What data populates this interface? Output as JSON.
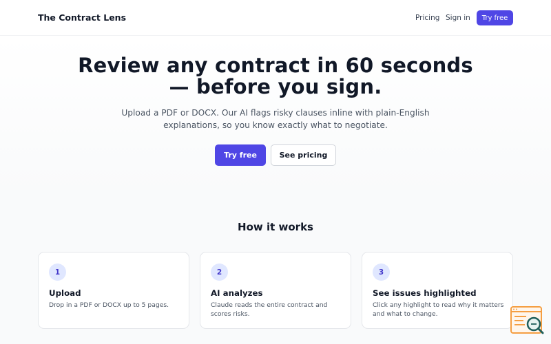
{
  "header": {
    "brand": "The Contract Lens",
    "nav": {
      "pricing": "Pricing",
      "sign_in": "Sign in",
      "try_free": "Try free"
    }
  },
  "hero": {
    "title": "Review any contract in 60 seconds — before you sign.",
    "subtitle": "Upload a PDF or DOCX. Our AI flags risky clauses inline with plain-English explanations, so you know exactly what to negotiate.",
    "primary_button": "Try free",
    "secondary_button": "See pricing"
  },
  "how_it_works": {
    "title": "How it works",
    "steps": [
      {
        "number": "1",
        "title": "Upload",
        "text": "Drop in a PDF or DOCX up to 5 pages."
      },
      {
        "number": "2",
        "title": "AI analyzes",
        "text": "Claude reads the entire contract and scores risks."
      },
      {
        "number": "3",
        "title": "See issues highlighted",
        "text": "Click any highlight to read why it matters and what to change."
      }
    ]
  },
  "corner_widget": {
    "icon": "search-document-icon"
  },
  "colors": {
    "accent": "#4f46e5",
    "badge_bg": "#e0e7ff",
    "badge_text": "#4338ca",
    "widget_orange": "#f59e42",
    "widget_teal": "#1f5f5b"
  }
}
